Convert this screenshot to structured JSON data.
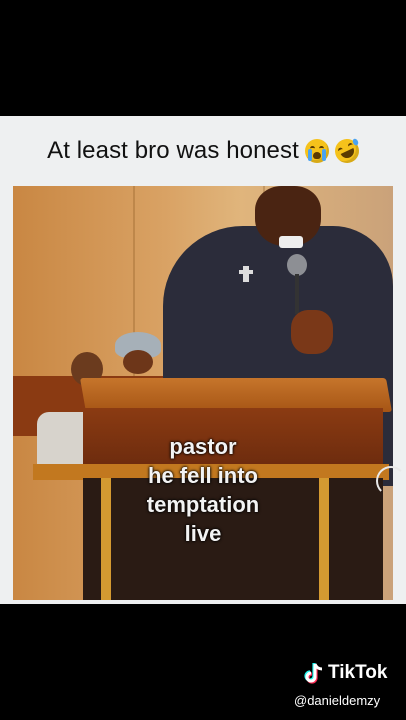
{
  "post": {
    "caption": "At least bro was honest",
    "emojis": [
      "crying-face-emoji",
      "rolling-on-floor-laughing-emoji"
    ]
  },
  "video": {
    "overlay_lines": [
      "pastor",
      "he fell into",
      "temptation",
      "live"
    ]
  },
  "watermark": {
    "brand": "TikTok",
    "handle": "@danieldemzy",
    "icon": "tiktok-logo-icon"
  }
}
